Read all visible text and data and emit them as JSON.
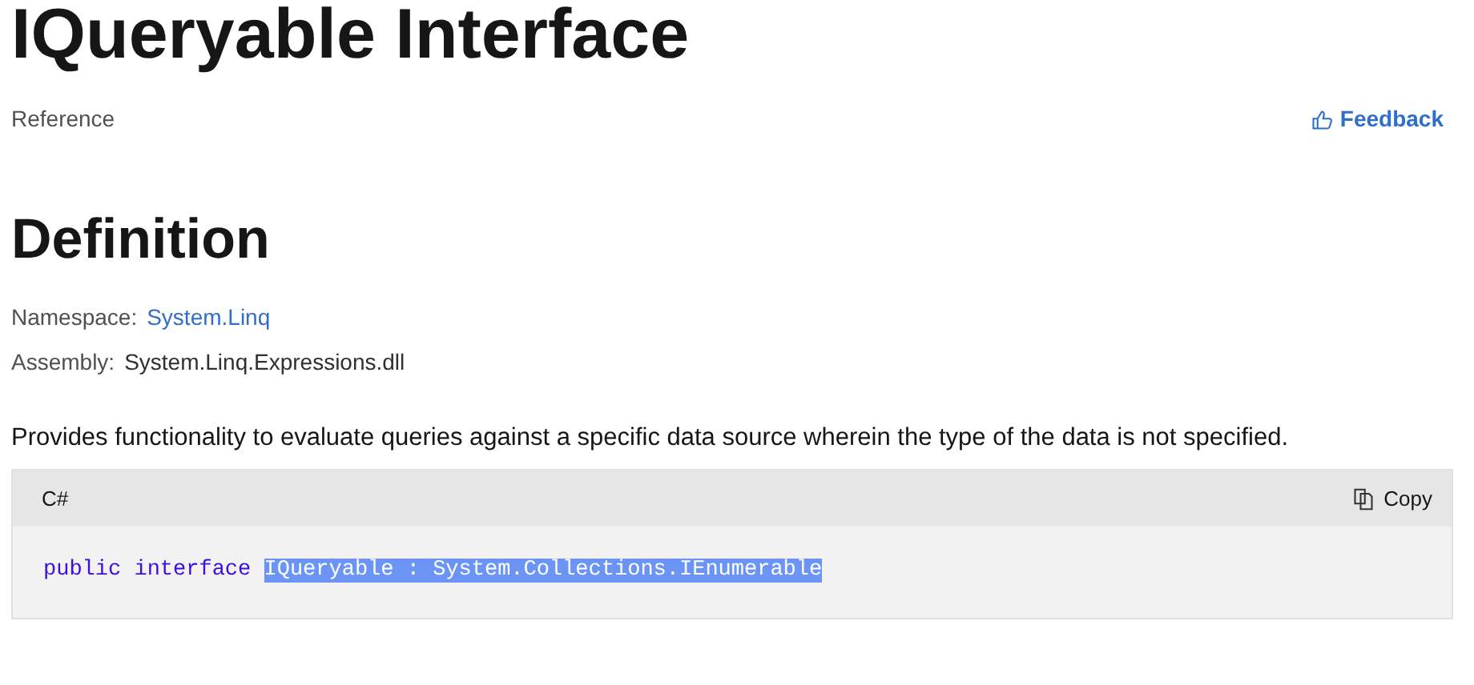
{
  "title": "IQueryable Interface",
  "breadcrumb": "Reference",
  "feedback_link": "Feedback",
  "section_heading": "Definition",
  "facts": [
    {
      "label": "Namespace:",
      "value": "System.Linq",
      "kind": "link"
    },
    {
      "label": "Assembly:",
      "value": "System.Linq.Expressions.dll",
      "kind": "text"
    }
  ],
  "summary": "Provides functionality to evaluate queries against a specific data source wherein the type of the data is not specified.",
  "code_block": {
    "language": "C#",
    "copy_button": "Copy",
    "tokens": [
      {
        "text": "public",
        "kind": "keyword",
        "selected": false
      },
      {
        "text": "interface",
        "kind": "keyword",
        "selected": false
      },
      {
        "text": "IQueryable : System.Collections.IEnumerable",
        "kind": "plain",
        "selected": true
      }
    ]
  }
}
